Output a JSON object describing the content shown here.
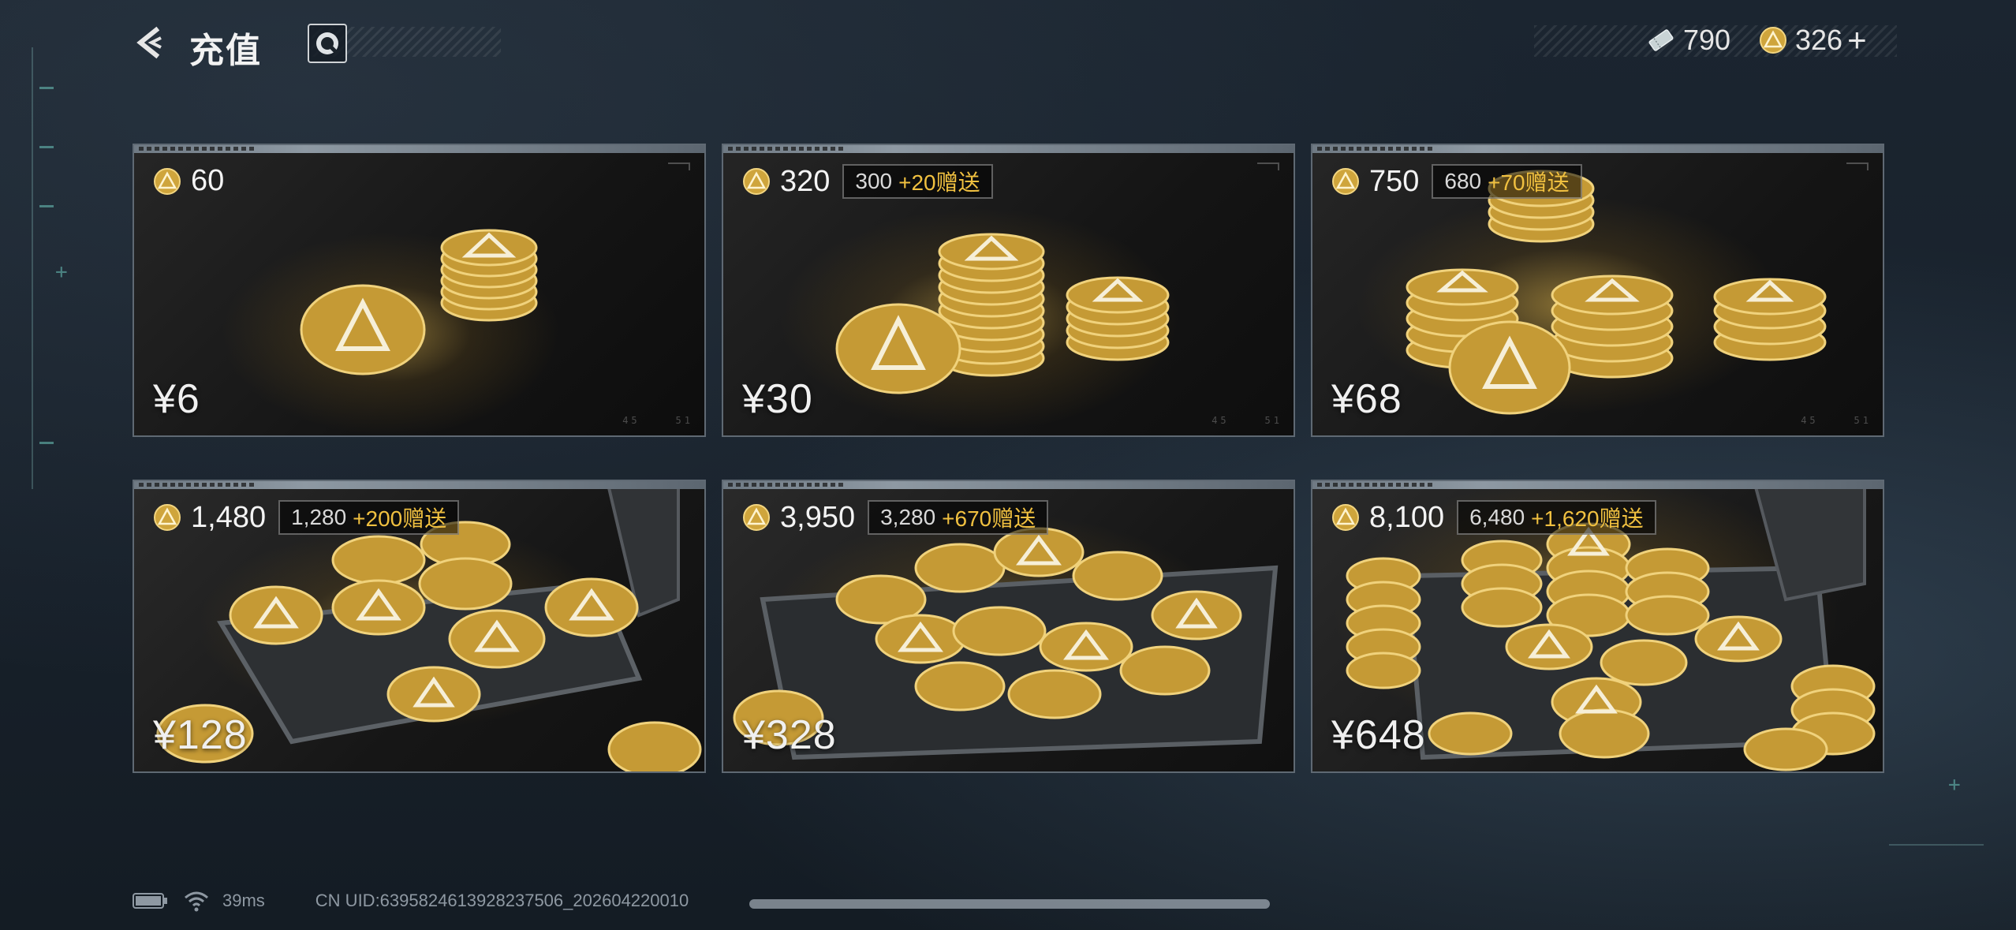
{
  "header": {
    "title": "充值"
  },
  "currency": {
    "tickets": "790",
    "coins": "326",
    "add_label": "+"
  },
  "packages": [
    {
      "coins": "60",
      "base": "",
      "bonus": "",
      "price": "¥6"
    },
    {
      "coins": "320",
      "base": "300",
      "bonus": "+20赠送",
      "price": "¥30"
    },
    {
      "coins": "750",
      "base": "680",
      "bonus": "+70赠送",
      "price": "¥68"
    },
    {
      "coins": "1,480",
      "base": "1,280",
      "bonus": "+200赠送",
      "price": "¥128"
    },
    {
      "coins": "3,950",
      "base": "3,280",
      "bonus": "+670赠送",
      "price": "¥328"
    },
    {
      "coins": "8,100",
      "base": "6,480",
      "bonus": "+1,620赠送",
      "price": "¥648"
    }
  ],
  "status": {
    "ping": "39ms",
    "uid": "CN UID:6395824613928237506_202604220010"
  },
  "colors": {
    "bonus_accent": "#f0c040",
    "coin_gold": "#d7b24a"
  }
}
